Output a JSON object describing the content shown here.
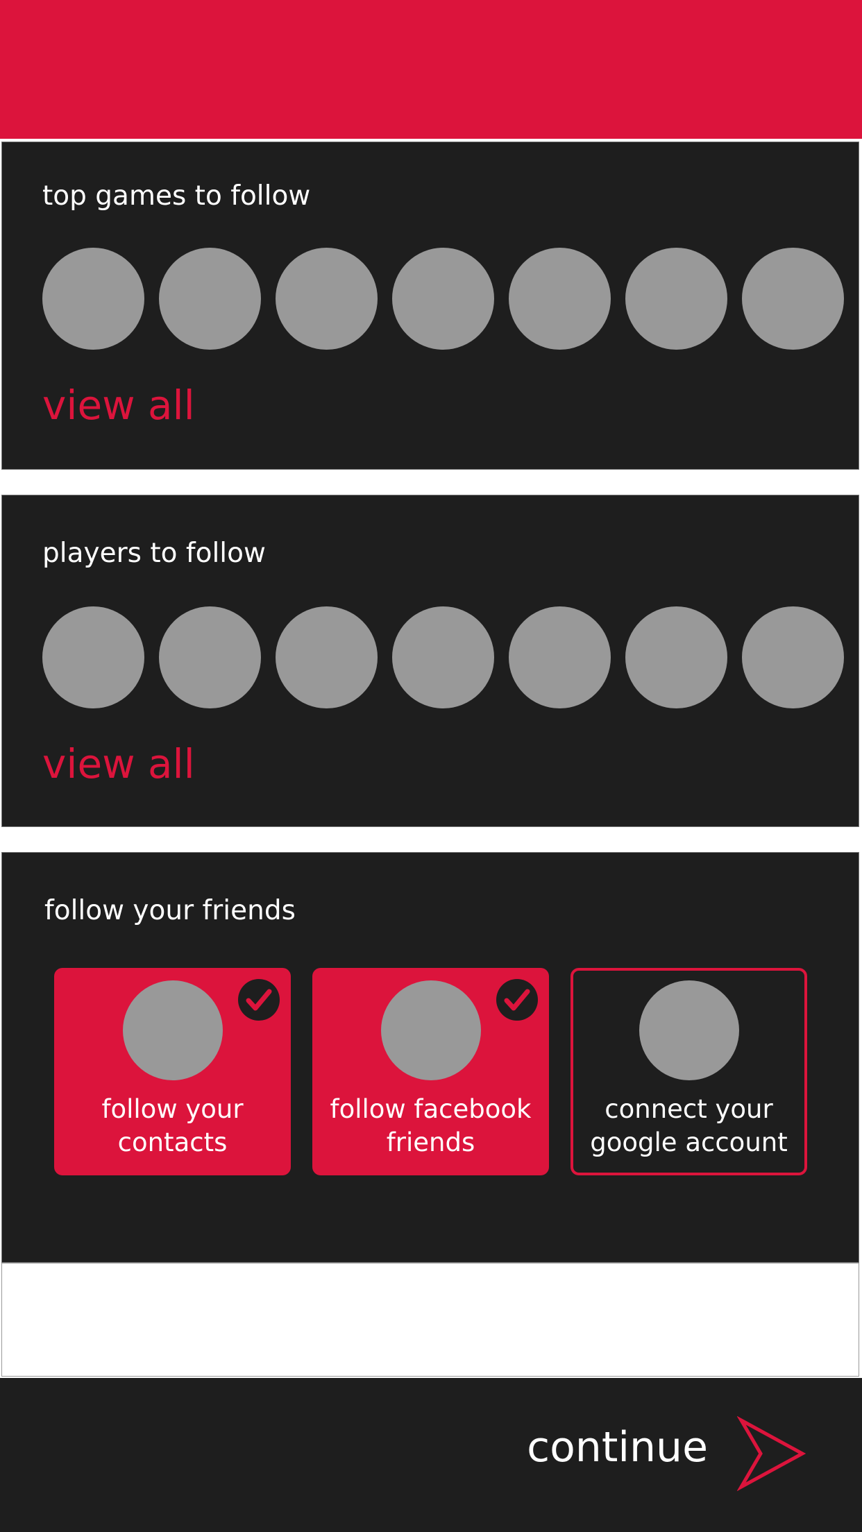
{
  "colors": {
    "accent": "#dc143c",
    "panel": "#1e1e1e",
    "placeholder": "#999999",
    "text": "#ffffff"
  },
  "sections": {
    "games": {
      "title": "top games to follow",
      "view_all": "view all"
    },
    "players": {
      "title": "players to follow",
      "view_all": "view all"
    },
    "friends": {
      "title": "follow your friends",
      "cards": [
        {
          "label_line1": "follow your",
          "label_line2": "contacts",
          "selected": true,
          "icon": "checkmark-icon"
        },
        {
          "label_line1": "follow facebook",
          "label_line2": "friends",
          "selected": true,
          "icon": "checkmark-icon"
        },
        {
          "label_line1": "connect your",
          "label_line2": "google account",
          "selected": false
        }
      ]
    }
  },
  "footer": {
    "continue_label": "continue",
    "icon": "arrow-right-icon"
  }
}
